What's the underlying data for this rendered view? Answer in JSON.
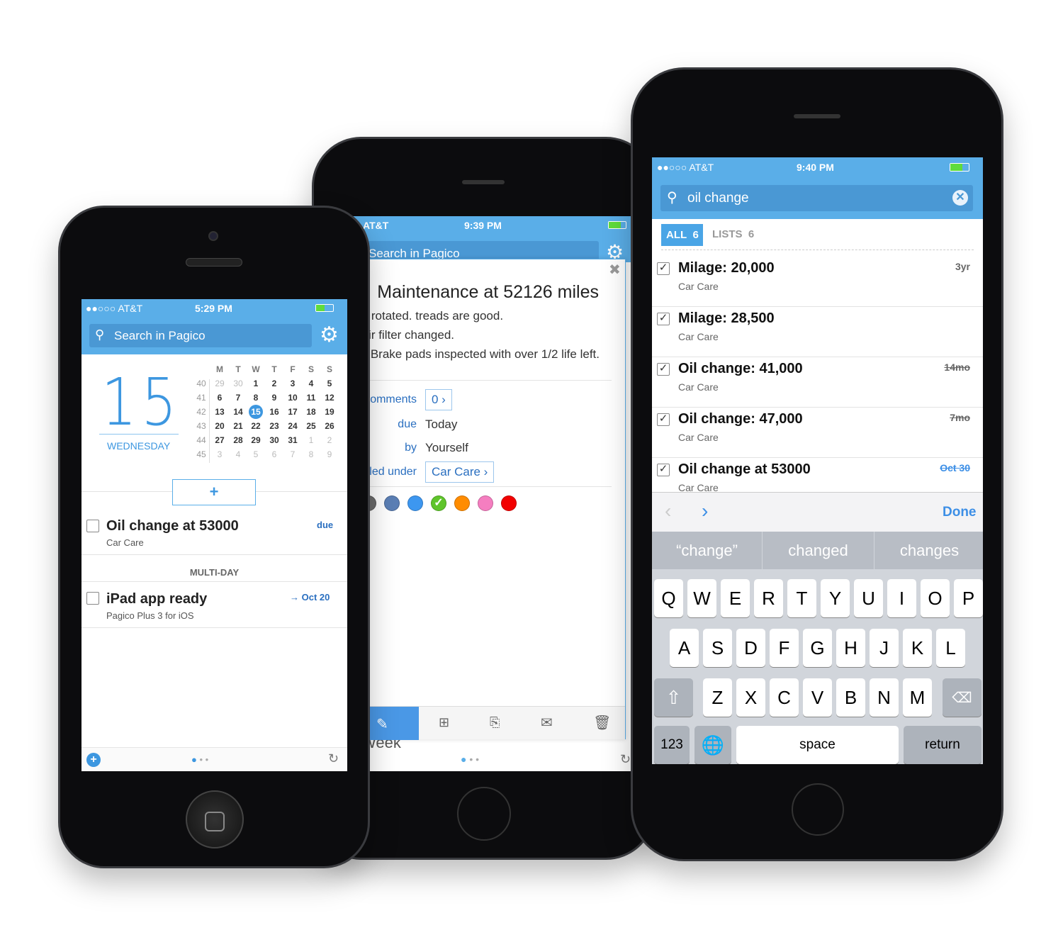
{
  "left_phone": {
    "status": {
      "carrier": "●●○○○ AT&T",
      "time": "5:29 PM"
    },
    "search_placeholder": "Search in Pagico",
    "day_number": "15",
    "weekday": "WEDNESDAY",
    "calendar": {
      "headers": [
        "M",
        "T",
        "W",
        "T",
        "F",
        "S",
        "S"
      ],
      "weeks": [
        "40",
        "41",
        "42",
        "43",
        "44",
        "45"
      ],
      "days": [
        [
          "29",
          "30",
          "1",
          "2",
          "3",
          "4",
          "5"
        ],
        [
          "6",
          "7",
          "8",
          "9",
          "10",
          "11",
          "12"
        ],
        [
          "13",
          "14",
          "15",
          "16",
          "17",
          "18",
          "19"
        ],
        [
          "20",
          "21",
          "22",
          "23",
          "24",
          "25",
          "26"
        ],
        [
          "27",
          "28",
          "29",
          "30",
          "31",
          "1",
          "2"
        ],
        [
          "3",
          "4",
          "5",
          "6",
          "7",
          "8",
          "9"
        ]
      ],
      "today": "15"
    },
    "add_label": "+",
    "tasks": [
      {
        "title": "Oil change at 53000",
        "list": "Car Care",
        "due": "due"
      }
    ],
    "section": "MULTI-DAY",
    "multiday": [
      {
        "title": "iPad app ready",
        "list": "Pagico Plus 3 for iOS",
        "due": "→ Oct 20"
      }
    ]
  },
  "middle_phone": {
    "status": {
      "carrier": "AT&T",
      "time": "9:39 PM"
    },
    "search_placeholder": "Search in Pagico",
    "back_fragment": "K",
    "task_title": "Maintenance at 52126 miles",
    "notes": [
      "Tires rotated. treads are good.",
      "Cabin air filter changed.",
      "Brake pads inspected with over 1/2 life left."
    ],
    "fields": {
      "comments_label": "Comments",
      "comments_value": "0 ›",
      "due_label": "due",
      "due_value": "Today",
      "by_label": "by",
      "by_value": "Yourself",
      "filed_label": "Filed under",
      "filed_value": "Car Care ›"
    },
    "colors": [
      "#ffffff",
      "#6b6b6b",
      "#5b7fb5",
      "#3d97f0",
      "#5fc52b",
      "#ff8c00",
      "#f57ec0",
      "#f20000"
    ],
    "selected_color": 4,
    "behind_text": "Week"
  },
  "right_phone": {
    "status": {
      "carrier": "●●○○○ AT&T",
      "time": "9:40 PM"
    },
    "search_value": "oil change",
    "tabs": [
      {
        "label": "ALL",
        "count": "6",
        "active": true
      },
      {
        "label": "LISTS",
        "count": "6",
        "active": false
      }
    ],
    "results": [
      {
        "title": "Milage: 20,000",
        "list": "Car Care",
        "meta": "3yr",
        "strike": false
      },
      {
        "title": "Milage: 28,500",
        "list": "Car Care",
        "meta": "",
        "strike": false
      },
      {
        "title": "Oil change: 41,000",
        "list": "Car Care",
        "meta": "14mo",
        "strike": true
      },
      {
        "title": "Oil change: 47,000",
        "list": "Car Care",
        "meta": "7mo",
        "strike": true
      },
      {
        "title": "Oil change at 53000",
        "list": "Car Care",
        "meta": "Oct 30",
        "strike": true
      }
    ],
    "done_label": "Done",
    "suggestions": [
      "“change”",
      "changed",
      "changes"
    ],
    "keyboard": {
      "row1": [
        "Q",
        "W",
        "E",
        "R",
        "T",
        "Y",
        "U",
        "I",
        "O",
        "P"
      ],
      "row2": [
        "A",
        "S",
        "D",
        "F",
        "G",
        "H",
        "J",
        "K",
        "L"
      ],
      "row3": [
        "Z",
        "X",
        "C",
        "V",
        "B",
        "N",
        "M"
      ],
      "numbers": "123",
      "space": "space",
      "return": "return"
    }
  },
  "accent": "#5aaee8"
}
